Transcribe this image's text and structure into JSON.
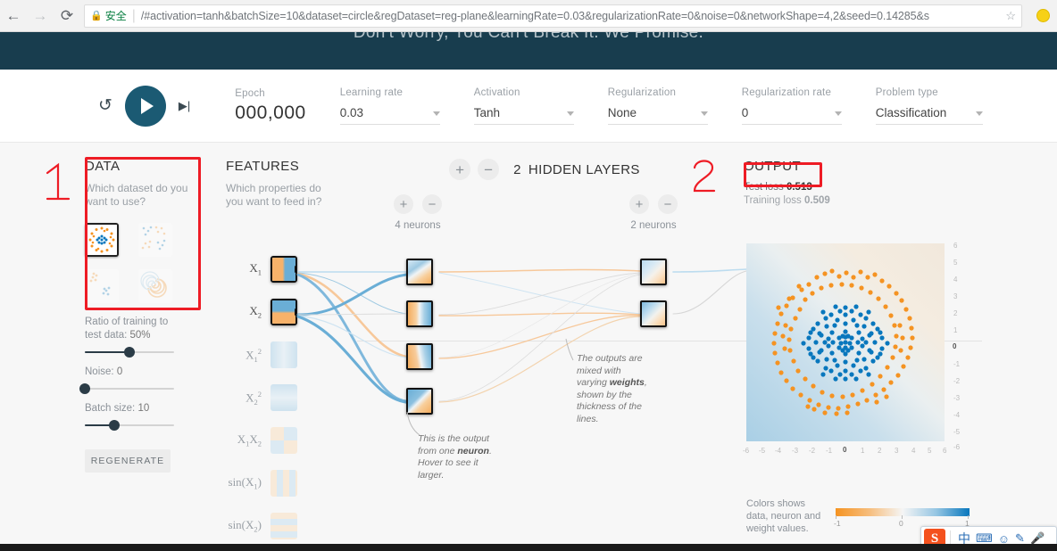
{
  "browser": {
    "back_icon": "back-arrow-icon",
    "forward_icon": "forward-arrow-icon",
    "reload_icon": "reload-icon",
    "secure_label": "安全",
    "url": "/#activation=tanh&batchSize=10&dataset=circle&regDataset=reg-plane&learningRate=0.03&regularizationRate=0&noise=0&networkShape=4,2&seed=0.14285&s",
    "star_icon": "bookmark-star-icon"
  },
  "banner": {
    "text": "Don't Worry, You Can't Break It. We Promise."
  },
  "toolbar": {
    "reset_icon": "reset-icon",
    "play_icon": "play-icon",
    "step_icon": "step-forward-icon",
    "epoch_label": "Epoch",
    "epoch_value": "000,000",
    "learning_rate": {
      "label": "Learning rate",
      "value": "0.03"
    },
    "activation": {
      "label": "Activation",
      "value": "Tanh"
    },
    "regularization": {
      "label": "Regularization",
      "value": "None"
    },
    "regularization_rate": {
      "label": "Regularization rate",
      "value": "0"
    },
    "problem_type": {
      "label": "Problem type",
      "value": "Classification"
    }
  },
  "data_panel": {
    "title": "DATA",
    "subtitle": "Which dataset do you want to use?",
    "datasets": [
      {
        "name": "circle",
        "selected": true
      },
      {
        "name": "exclusive-or",
        "selected": false
      },
      {
        "name": "gaussian",
        "selected": false
      },
      {
        "name": "spiral",
        "selected": false
      }
    ],
    "ratio_label": "Ratio of training to test data:",
    "ratio_value": "50%",
    "noise_label": "Noise:",
    "noise_value": "0",
    "batch_label": "Batch size:",
    "batch_value": "10",
    "regenerate_label": "REGENERATE"
  },
  "features_panel": {
    "title": "FEATURES",
    "subtitle": "Which properties do you want to feed in?",
    "features": [
      {
        "label": "X₁",
        "active": true
      },
      {
        "label": "X₂",
        "active": true
      },
      {
        "label": "X₁²",
        "active": false
      },
      {
        "label": "X₂²",
        "active": false
      },
      {
        "label": "X₁X₂",
        "active": false
      },
      {
        "label": "sin(X₁)",
        "active": false
      },
      {
        "label": "sin(X₂)",
        "active": false
      }
    ]
  },
  "network": {
    "add_layer_label": "+",
    "remove_layer_label": "−",
    "hidden_layers_count": "2",
    "hidden_layers_label": "HIDDEN LAYERS",
    "layers": [
      {
        "neuron_count_label": "4 neurons",
        "neurons": 4
      },
      {
        "neuron_count_label": "2 neurons",
        "neurons": 2
      }
    ],
    "callout_neuron": "This is the output from one neuron. Hover to see it larger.",
    "callout_neuron_parts": {
      "a": "This is the output from one ",
      "b": "neuron",
      "c": ". Hover to see it larger."
    },
    "callout_weights_parts": {
      "a": "The outputs are mixed with varying ",
      "b": "weights",
      "c": ", shown by the thickness of the lines."
    }
  },
  "output_panel": {
    "title": "OUTPUT",
    "test_loss_label": "Test loss",
    "test_loss_value": "0.513",
    "training_loss_label": "Training loss",
    "training_loss_value": "0.509",
    "legend_text": "Colors shows data, neuron and weight values.",
    "legend_ticks": [
      "-1",
      "0",
      "1"
    ]
  },
  "annotations": {
    "mark_1": "1",
    "mark_2": "2",
    "color": "#ee1c25"
  },
  "ime": {
    "logo": "S",
    "mode": "中",
    "icons": [
      "keyboard-icon",
      "emoji-icon",
      "pen-icon",
      "microphone-icon"
    ]
  },
  "chart_data": {
    "type": "scatter",
    "title": "OUTPUT",
    "xlabel": "",
    "ylabel": "",
    "xlim": [
      -6,
      6
    ],
    "ylim": [
      -6,
      6
    ],
    "xticks": [
      "-6",
      "-5",
      "-4",
      "-3",
      "-2",
      "-1",
      "0",
      "1",
      "2",
      "3",
      "4",
      "5",
      "6"
    ],
    "yticks": [
      "6",
      "5",
      "4",
      "3",
      "2",
      "1",
      "0",
      "-1",
      "-2",
      "-3",
      "-4",
      "-5",
      "-6"
    ],
    "grid": false,
    "legend": "Colors shows data, neuron and weight values.",
    "series": [
      {
        "name": "class-positive",
        "color": "#0877bd",
        "description": "inner circle cluster (radius < ~2.2)",
        "count": 120
      },
      {
        "name": "class-negative",
        "color": "#f59322",
        "description": "outer ring cluster (radius ~3.2-5)",
        "count": 130
      }
    ],
    "background": "decision surface heatmap, light blue to light orange diagonal gradient"
  }
}
